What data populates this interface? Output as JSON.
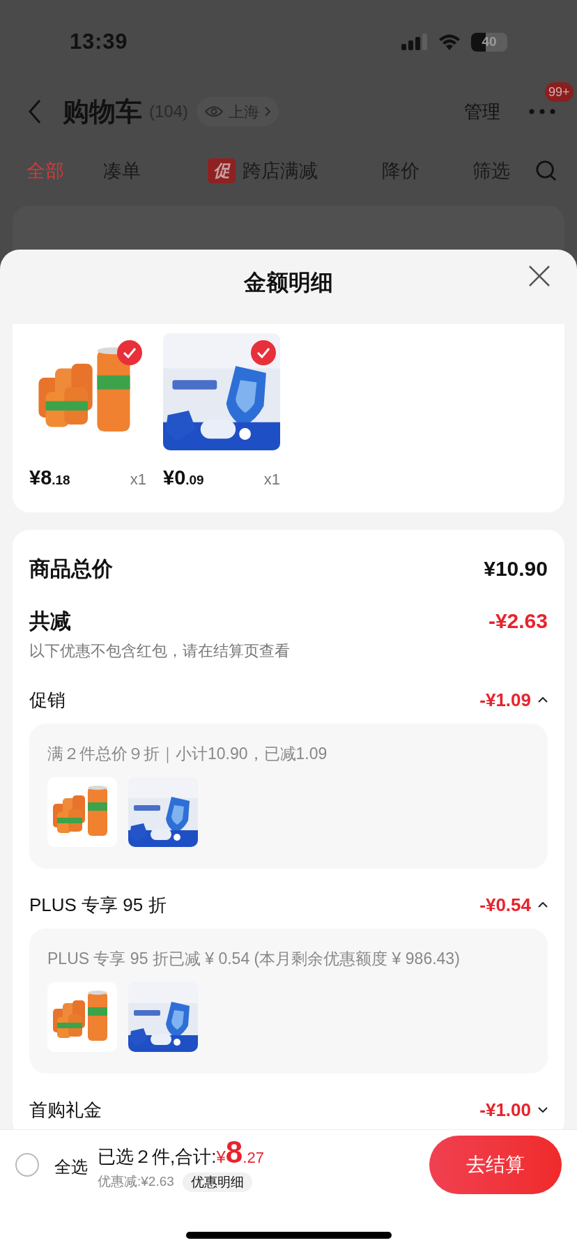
{
  "status_bar": {
    "time": "13:39",
    "battery": "40"
  },
  "nav": {
    "title": "购物车",
    "count": "(104)",
    "location": "上海",
    "manage": "管理",
    "badge": "99+"
  },
  "tabs": [
    {
      "label": "全部",
      "selected": true
    },
    {
      "label": "凑单",
      "selected": false
    },
    {
      "label": "跨店满减",
      "selected": false,
      "tag": "促"
    },
    {
      "label": "降价",
      "selected": false
    },
    {
      "label": "筛选",
      "selected": false
    }
  ],
  "sheet": {
    "title": "金额明细",
    "items": [
      {
        "price": "¥8",
        "price_decimal": ".18",
        "quantity": "x1",
        "checked": true
      },
      {
        "price": "¥0",
        "price_decimal": ".09",
        "quantity": "x1",
        "checked": true
      }
    ],
    "total_label": "商品总价",
    "total": "¥10.90",
    "reduced_label": "共减",
    "reduced": "-¥2.63",
    "note": "以下优惠不包含红包，请在结算页查看",
    "discounts": [
      {
        "label": "促销",
        "amount": "-¥1.09",
        "expanded": true,
        "detail": "满２件总价９折｜小计10.90，已减1.09"
      },
      {
        "label": "PLUS 专享 95 折",
        "amount": "-¥0.54",
        "expanded": true,
        "detail": "PLUS 专享 95 折已减 ¥ 0.54 (本月剩余优惠额度 ¥ 986.43)"
      },
      {
        "label": "首购礼金",
        "amount": "-¥1.00",
        "expanded": false
      }
    ]
  },
  "bottom_bar": {
    "select_all": "全选",
    "select_all_checked": false,
    "summary": "已选２件,合计:",
    "currency": "¥",
    "total": "8",
    "total_decimal": ".27",
    "saved": "优惠减:¥2.63",
    "detail_button": "优惠明细",
    "checkout": "去结算"
  }
}
